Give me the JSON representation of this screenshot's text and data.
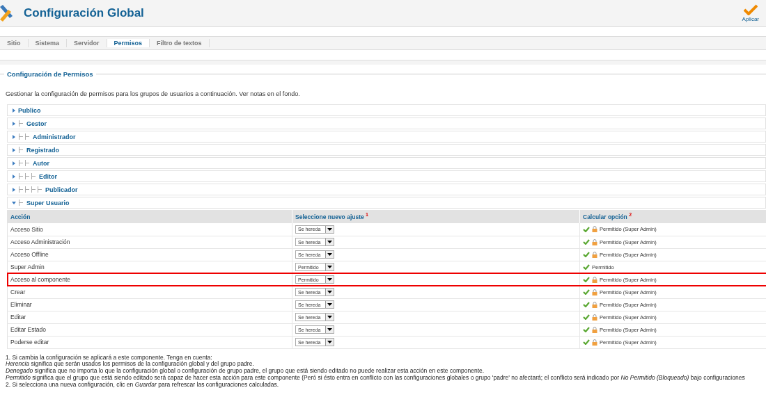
{
  "header": {
    "title": "Configuración Global",
    "apply_button": "Aplicar"
  },
  "tabs": [
    {
      "label": "Sitio",
      "selected": false
    },
    {
      "label": "Sistema",
      "selected": false
    },
    {
      "label": "Servidor",
      "selected": false
    },
    {
      "label": "Permisos",
      "selected": true
    },
    {
      "label": "Filtro de textos",
      "selected": false
    }
  ],
  "section": {
    "legend": "Configuración de Permisos",
    "intro": "Gestionar la configuración de permisos para los grupos de usuarios a continuación. Ver notas en el fondo.",
    "groups": [
      {
        "name": "Publico",
        "expanded": false,
        "children": [
          {
            "name": "Gestor",
            "expanded": false,
            "children": [
              {
                "name": "Administrador",
                "expanded": false
              }
            ]
          },
          {
            "name": "Registrado",
            "expanded": false,
            "children": [
              {
                "name": "Autor",
                "expanded": false,
                "children": [
                  {
                    "name": "Editor",
                    "expanded": false,
                    "children": [
                      {
                        "name": "Publicador",
                        "expanded": false
                      }
                    ]
                  }
                ]
              }
            ]
          },
          {
            "name": "Super Usuario",
            "expanded": true,
            "permissions": {
              "columns": [
                "Acción",
                "Seleccione nuevo ajuste $^{1}$",
                "Calcular opción $^{2}$"
              ],
              "rows": [
                {
                  "action": "Acceso Sitio",
                  "setting": "Se hereda",
                  "calculated": "Permitido (Super Admin)",
                  "locked": true,
                  "highlighted": false
                },
                {
                  "action": "Acceso Administración",
                  "setting": "Se hereda",
                  "calculated": "Permitido (Super Admin)",
                  "locked": true,
                  "highlighted": false
                },
                {
                  "action": "Acceso Offline",
                  "setting": "Se hereda",
                  "calculated": "Permitido (Super Admin)",
                  "locked": true,
                  "highlighted": false
                },
                {
                  "action": "Super Admin",
                  "setting": "Permitido",
                  "calculated": "Permitido",
                  "locked": false,
                  "highlighted": false
                },
                {
                  "action": "Acceso al componente",
                  "setting": "Permitido",
                  "calculated": "Permitido (Super Admin)",
                  "locked": true,
                  "highlighted": true
                },
                {
                  "action": "Crear",
                  "setting": "Se hereda",
                  "calculated": "Permitido (Super Admin)",
                  "locked": true,
                  "highlighted": false
                },
                {
                  "action": "Eliminar",
                  "setting": "Se hereda",
                  "calculated": "Permitido (Super Admin)",
                  "locked": true,
                  "highlighted": false
                },
                {
                  "action": "Editar",
                  "setting": "Se hereda",
                  "calculated": "Permitido (Super Admin)",
                  "locked": true,
                  "highlighted": false
                },
                {
                  "action": "Editar Estado",
                  "setting": "Se hereda",
                  "calculated": "Permitido (Super Admin)",
                  "locked": true,
                  "highlighted": false
                },
                {
                  "action": "Poderse editar",
                  "setting": "Se hereda",
                  "calculated": "Permitido (Super Admin)",
                  "locked": true,
                  "highlighted": false
                }
              ]
            }
          }
        ]
      }
    ]
  },
  "notes": [
    "1. Si cambia la configuración se aplicará a este componente. Tenga en cuenta:",
    "*Herencia* significa que serán usados los permisos de la configuración global y del grupo padre.",
    "*Denegado* significa que no importa lo que la configuración global o configuración de grupo padre, el grupo que está siendo editado no puede realizar esta acción en este componente.",
    "*Permitido* significa que el grupo que está siendo editado será capaz de hacer esta acción para este componente (Peró si ésto entra en conflicto con las configuraciones globales o grupo 'padre' no afectará; el conflicto será indicado por *No Permitido (Bloqueado)* bajo configuraciones",
    "2. Si selecciona una nueva configuración, clic en *Guardar* para refrescar las configuraciones calculadas."
  ]
}
